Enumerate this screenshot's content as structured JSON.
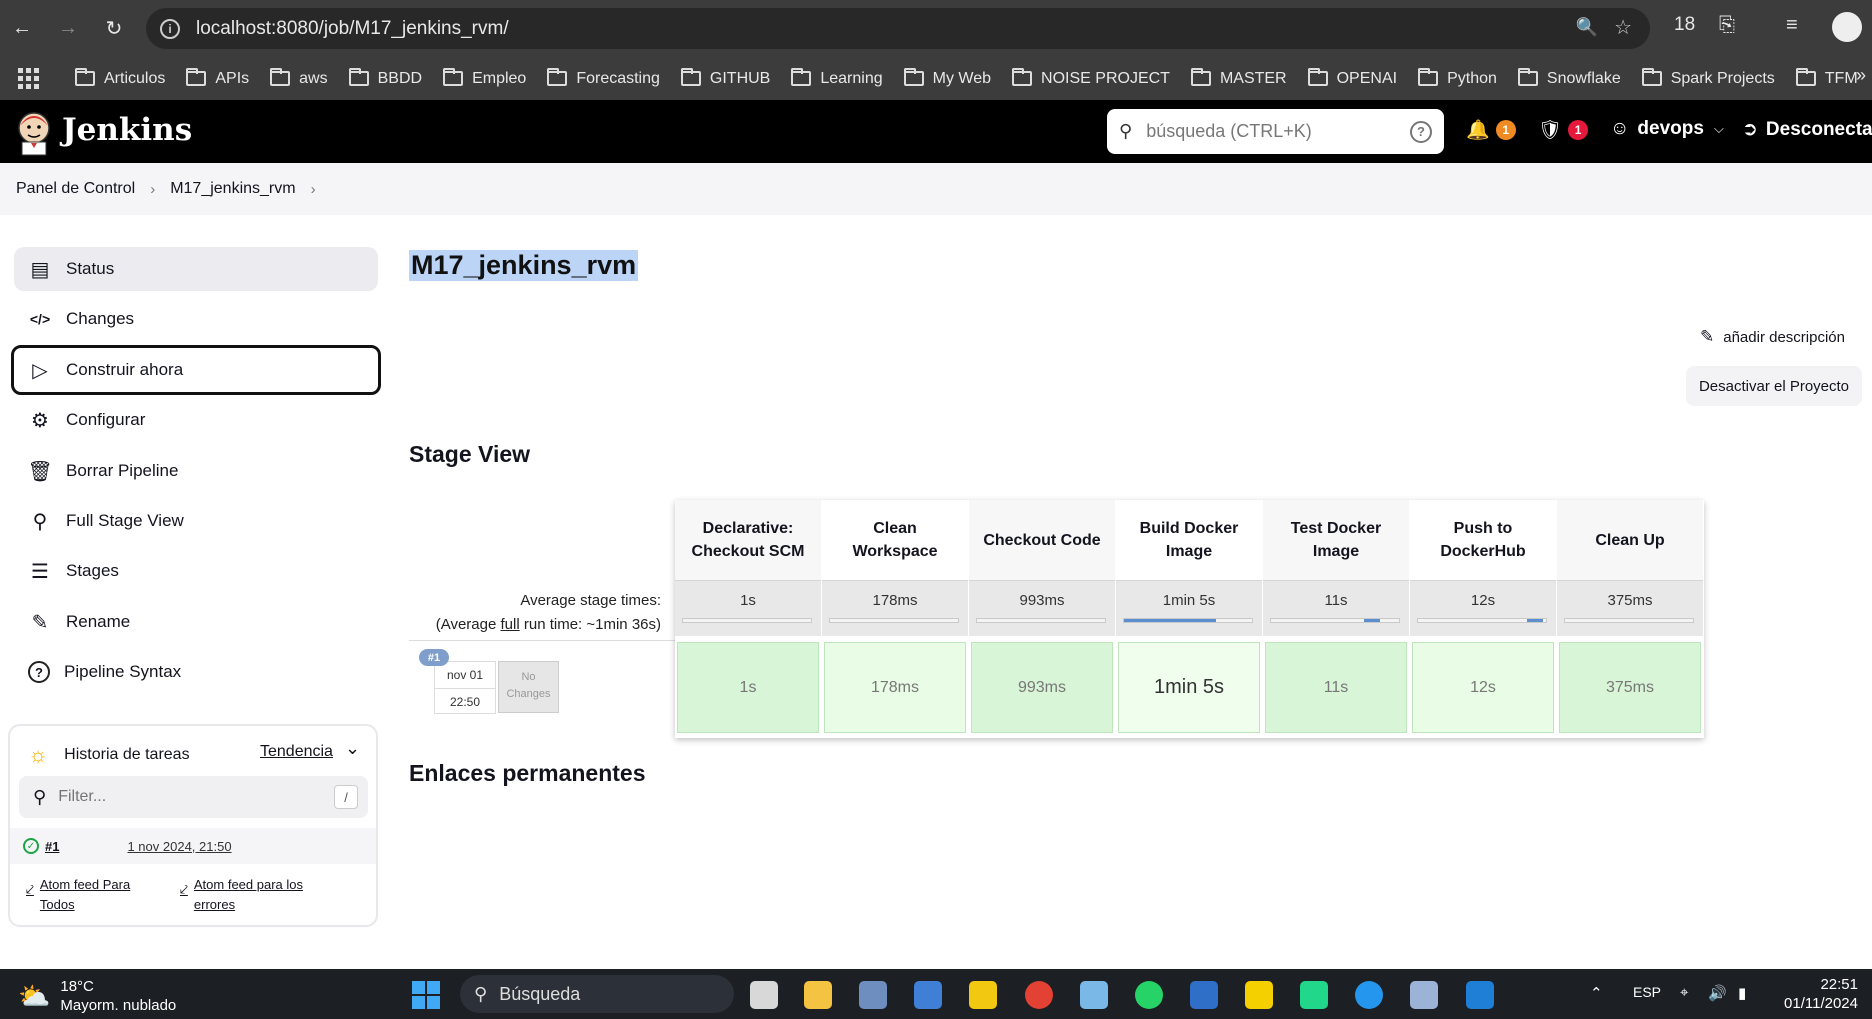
{
  "browser": {
    "url": "localhost:8080/job/M17_jenkins_rvm/",
    "tab_count": "18",
    "bookmarks": [
      "Articulos",
      "APIs",
      "aws",
      "BBDD",
      "Empleo",
      "Forecasting",
      "GITHUB",
      "Learning",
      "My Web",
      "NOISE PROJECT",
      "MASTER",
      "OPENAI",
      "Python",
      "Snowflake",
      "Spark Projects",
      "TFM"
    ]
  },
  "header": {
    "brand": "Jenkins",
    "search_placeholder": "búsqueda (CTRL+K)",
    "notifications_count": "1",
    "security_count": "1",
    "user": "devops",
    "logout": "Desconectar"
  },
  "breadcrumb": {
    "items": [
      "Panel de Control",
      "M17_jenkins_rvm"
    ]
  },
  "sidebar": {
    "items": [
      {
        "label": "Status",
        "icon": "status-icon"
      },
      {
        "label": "Changes",
        "icon": "code-icon"
      },
      {
        "label": "Construir ahora",
        "icon": "play-icon"
      },
      {
        "label": "Configurar",
        "icon": "gear-icon"
      },
      {
        "label": "Borrar Pipeline",
        "icon": "trash-icon"
      },
      {
        "label": "Full Stage View",
        "icon": "search-icon"
      },
      {
        "label": "Stages",
        "icon": "layers-icon"
      },
      {
        "label": "Rename",
        "icon": "pencil-icon"
      },
      {
        "label": "Pipeline Syntax",
        "icon": "help-icon"
      }
    ]
  },
  "history": {
    "title": "Historia de tareas",
    "trend": "Tendencia",
    "filter_placeholder": "Filter...",
    "filter_shortcut": "/",
    "builds": [
      {
        "number": "#1",
        "date": "1 nov 2024, 21:50",
        "status": "success"
      }
    ],
    "feed_all": "Atom feed Para Todos",
    "feed_errors": "Atom feed para los errores"
  },
  "main": {
    "title": "M17_jenkins_rvm",
    "add_description": "añadir descripción",
    "disable_project": "Desactivar el Proyecto",
    "stage_view_title": "Stage View",
    "permalinks_title": "Enlaces permanentes"
  },
  "stage_view": {
    "avg_label": "Average stage times:",
    "avg_full_prefix": "(Average ",
    "avg_full_link": "full",
    "avg_full_suffix": " run time: ~1min 36s)",
    "stages": [
      {
        "name": "Declarative: Checkout SCM",
        "avg": "1s",
        "run": "1s",
        "bar_start": 0.0,
        "bar_fill": 0.0
      },
      {
        "name": "Clean Workspace",
        "avg": "178ms",
        "run": "178ms",
        "bar_start": 0.0,
        "bar_fill": 0.0
      },
      {
        "name": "Checkout Code",
        "avg": "993ms",
        "run": "993ms",
        "bar_start": 0.0,
        "bar_fill": 0.0
      },
      {
        "name": "Build Docker Image",
        "avg": "1min 5s",
        "run": "1min 5s",
        "bar_start": 0.0,
        "bar_fill": 0.72
      },
      {
        "name": "Test Docker Image",
        "avg": "11s",
        "run": "11s",
        "bar_start": 0.73,
        "bar_fill": 0.12
      },
      {
        "name": "Push to DockerHub",
        "avg": "12s",
        "run": "12s",
        "bar_start": 0.85,
        "bar_fill": 0.13
      },
      {
        "name": "Clean Up",
        "avg": "375ms",
        "run": "375ms",
        "bar_start": 0.0,
        "bar_fill": 0.0
      }
    ],
    "run": {
      "badge": "#1",
      "date": "nov 01",
      "time": "22:50",
      "changes": "No Changes"
    }
  },
  "taskbar": {
    "temperature": "18°C",
    "weather": "Mayorm. nublado",
    "search": "Búsqueda",
    "lang": "ESP",
    "time": "22:51",
    "date": "01/11/2024"
  },
  "colors": {
    "jenkins_header": "#000000",
    "stage_success": "#d9f5d7",
    "bar_fill": "#5b8fd0",
    "notification_badge": "#f08a24",
    "security_badge": "#e5193b"
  }
}
